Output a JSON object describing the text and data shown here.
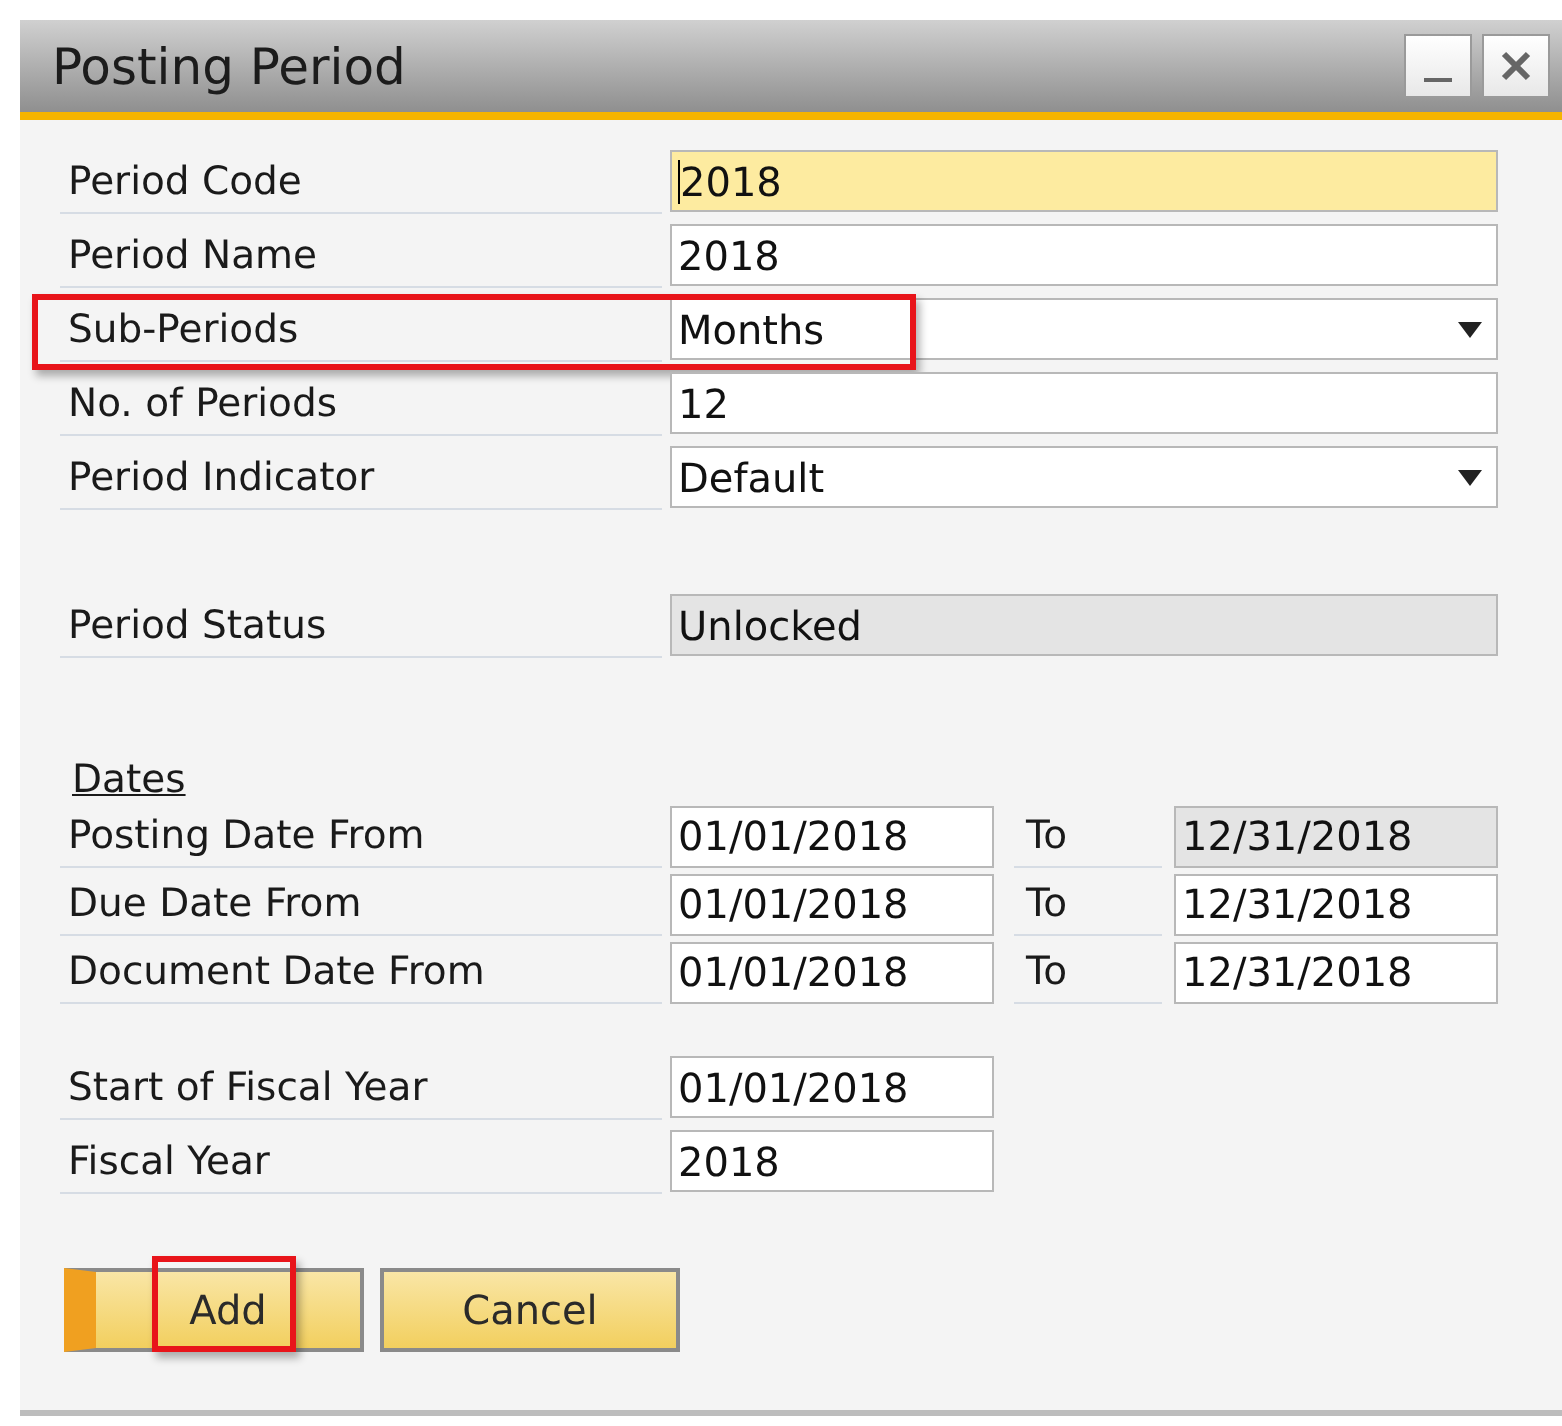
{
  "window": {
    "title": "Posting Period"
  },
  "general": [
    {
      "label": "Period Code",
      "kind": "text",
      "value": "2018",
      "focused": true,
      "highlighted": false
    },
    {
      "label": "Period Name",
      "kind": "text",
      "value": "2018",
      "focused": false,
      "highlighted": false
    },
    {
      "label": "Sub-Periods",
      "kind": "dropdown",
      "value": "Months",
      "focused": false,
      "highlighted": true
    },
    {
      "label": "No. of Periods",
      "kind": "text",
      "value": "12",
      "focused": false,
      "highlighted": false
    },
    {
      "label": "Period Indicator",
      "kind": "dropdown",
      "value": "Default",
      "focused": false,
      "highlighted": false
    }
  ],
  "status": {
    "label": "Period Status",
    "value": "Unlocked",
    "disabled": true
  },
  "dates": {
    "heading": "Dates",
    "rows": [
      {
        "label": "Posting Date From",
        "from": "01/01/2018",
        "to_label": "To",
        "to": "12/31/2018",
        "to_disabled": true
      },
      {
        "label": "Due Date From",
        "from": "01/01/2018",
        "to_label": "To",
        "to": "12/31/2018",
        "to_disabled": false
      },
      {
        "label": "Document Date From",
        "from": "01/01/2018",
        "to_label": "To",
        "to": "12/31/2018",
        "to_disabled": false
      }
    ]
  },
  "fiscal": [
    {
      "label": "Start of Fiscal Year",
      "value": "01/01/2018"
    },
    {
      "label": "Fiscal Year",
      "value": "2018"
    }
  ],
  "buttons": [
    {
      "label": "Add",
      "default": true,
      "highlighted": true
    },
    {
      "label": "Cancel",
      "default": false,
      "highlighted": false
    }
  ]
}
